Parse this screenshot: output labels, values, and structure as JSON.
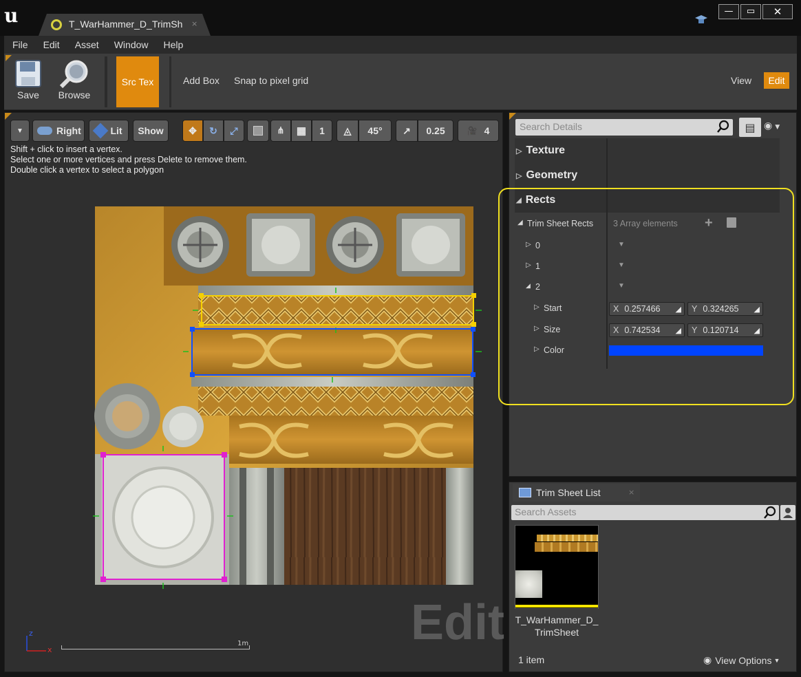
{
  "window": {
    "tab_title": "T_WarHammer_D_TrimSh",
    "minimize_glyph": "—",
    "maximize_glyph": "▭",
    "close_glyph": "✕"
  },
  "menu": {
    "items": [
      "File",
      "Edit",
      "Asset",
      "Window",
      "Help"
    ]
  },
  "toolbar": {
    "save_label": "Save",
    "browse_label": "Browse",
    "src_tex_label": "Src Tex",
    "add_box_label": "Add Box",
    "snap_label": "Snap to pixel grid",
    "view_label": "View",
    "edit_label": "Edit"
  },
  "viewport": {
    "view_label": "Right",
    "lit_label": "Lit",
    "show_label": "Show",
    "grid_value": "1",
    "angle_value": "45°",
    "scale_value": "0.25",
    "camera_speed": "4",
    "hints": [
      "Shift + click to insert a vertex.",
      "Select one or more vertices and press Delete to remove them.",
      "Double click a vertex to select a polygon"
    ],
    "mode_watermark": "Edit",
    "scale_label": "1m",
    "axis_z": "z",
    "axis_x": "x"
  },
  "details": {
    "search_placeholder": "Search Details",
    "sections": [
      "Texture",
      "Geometry",
      "Rects"
    ],
    "trim_sheet_rects_label": "Trim Sheet Rects",
    "array_count_label": "3 Array elements",
    "elements": [
      "0",
      "1",
      "2"
    ],
    "start_label": "Start",
    "size_label": "Size",
    "color_label": "Color",
    "x_label": "X",
    "y_label": "Y",
    "start_x": "0.257466",
    "start_y": "0.324265",
    "size_x": "0.742534",
    "size_y": "0.120714",
    "color_value": "#0044ff"
  },
  "trim_list": {
    "tab_label": "Trim Sheet List",
    "search_placeholder": "Search Assets",
    "asset_name_line1": "T_WarHammer_D_",
    "asset_name_line2": "TrimSheet",
    "item_count": "1 item",
    "view_options_label": "View Options"
  },
  "colors": {
    "accent": "#e08a0e",
    "highlight_outline": "#f0e020",
    "rect_yellow": "#f5d000",
    "rect_blue": "#1050ff",
    "rect_magenta": "#e020d0"
  }
}
